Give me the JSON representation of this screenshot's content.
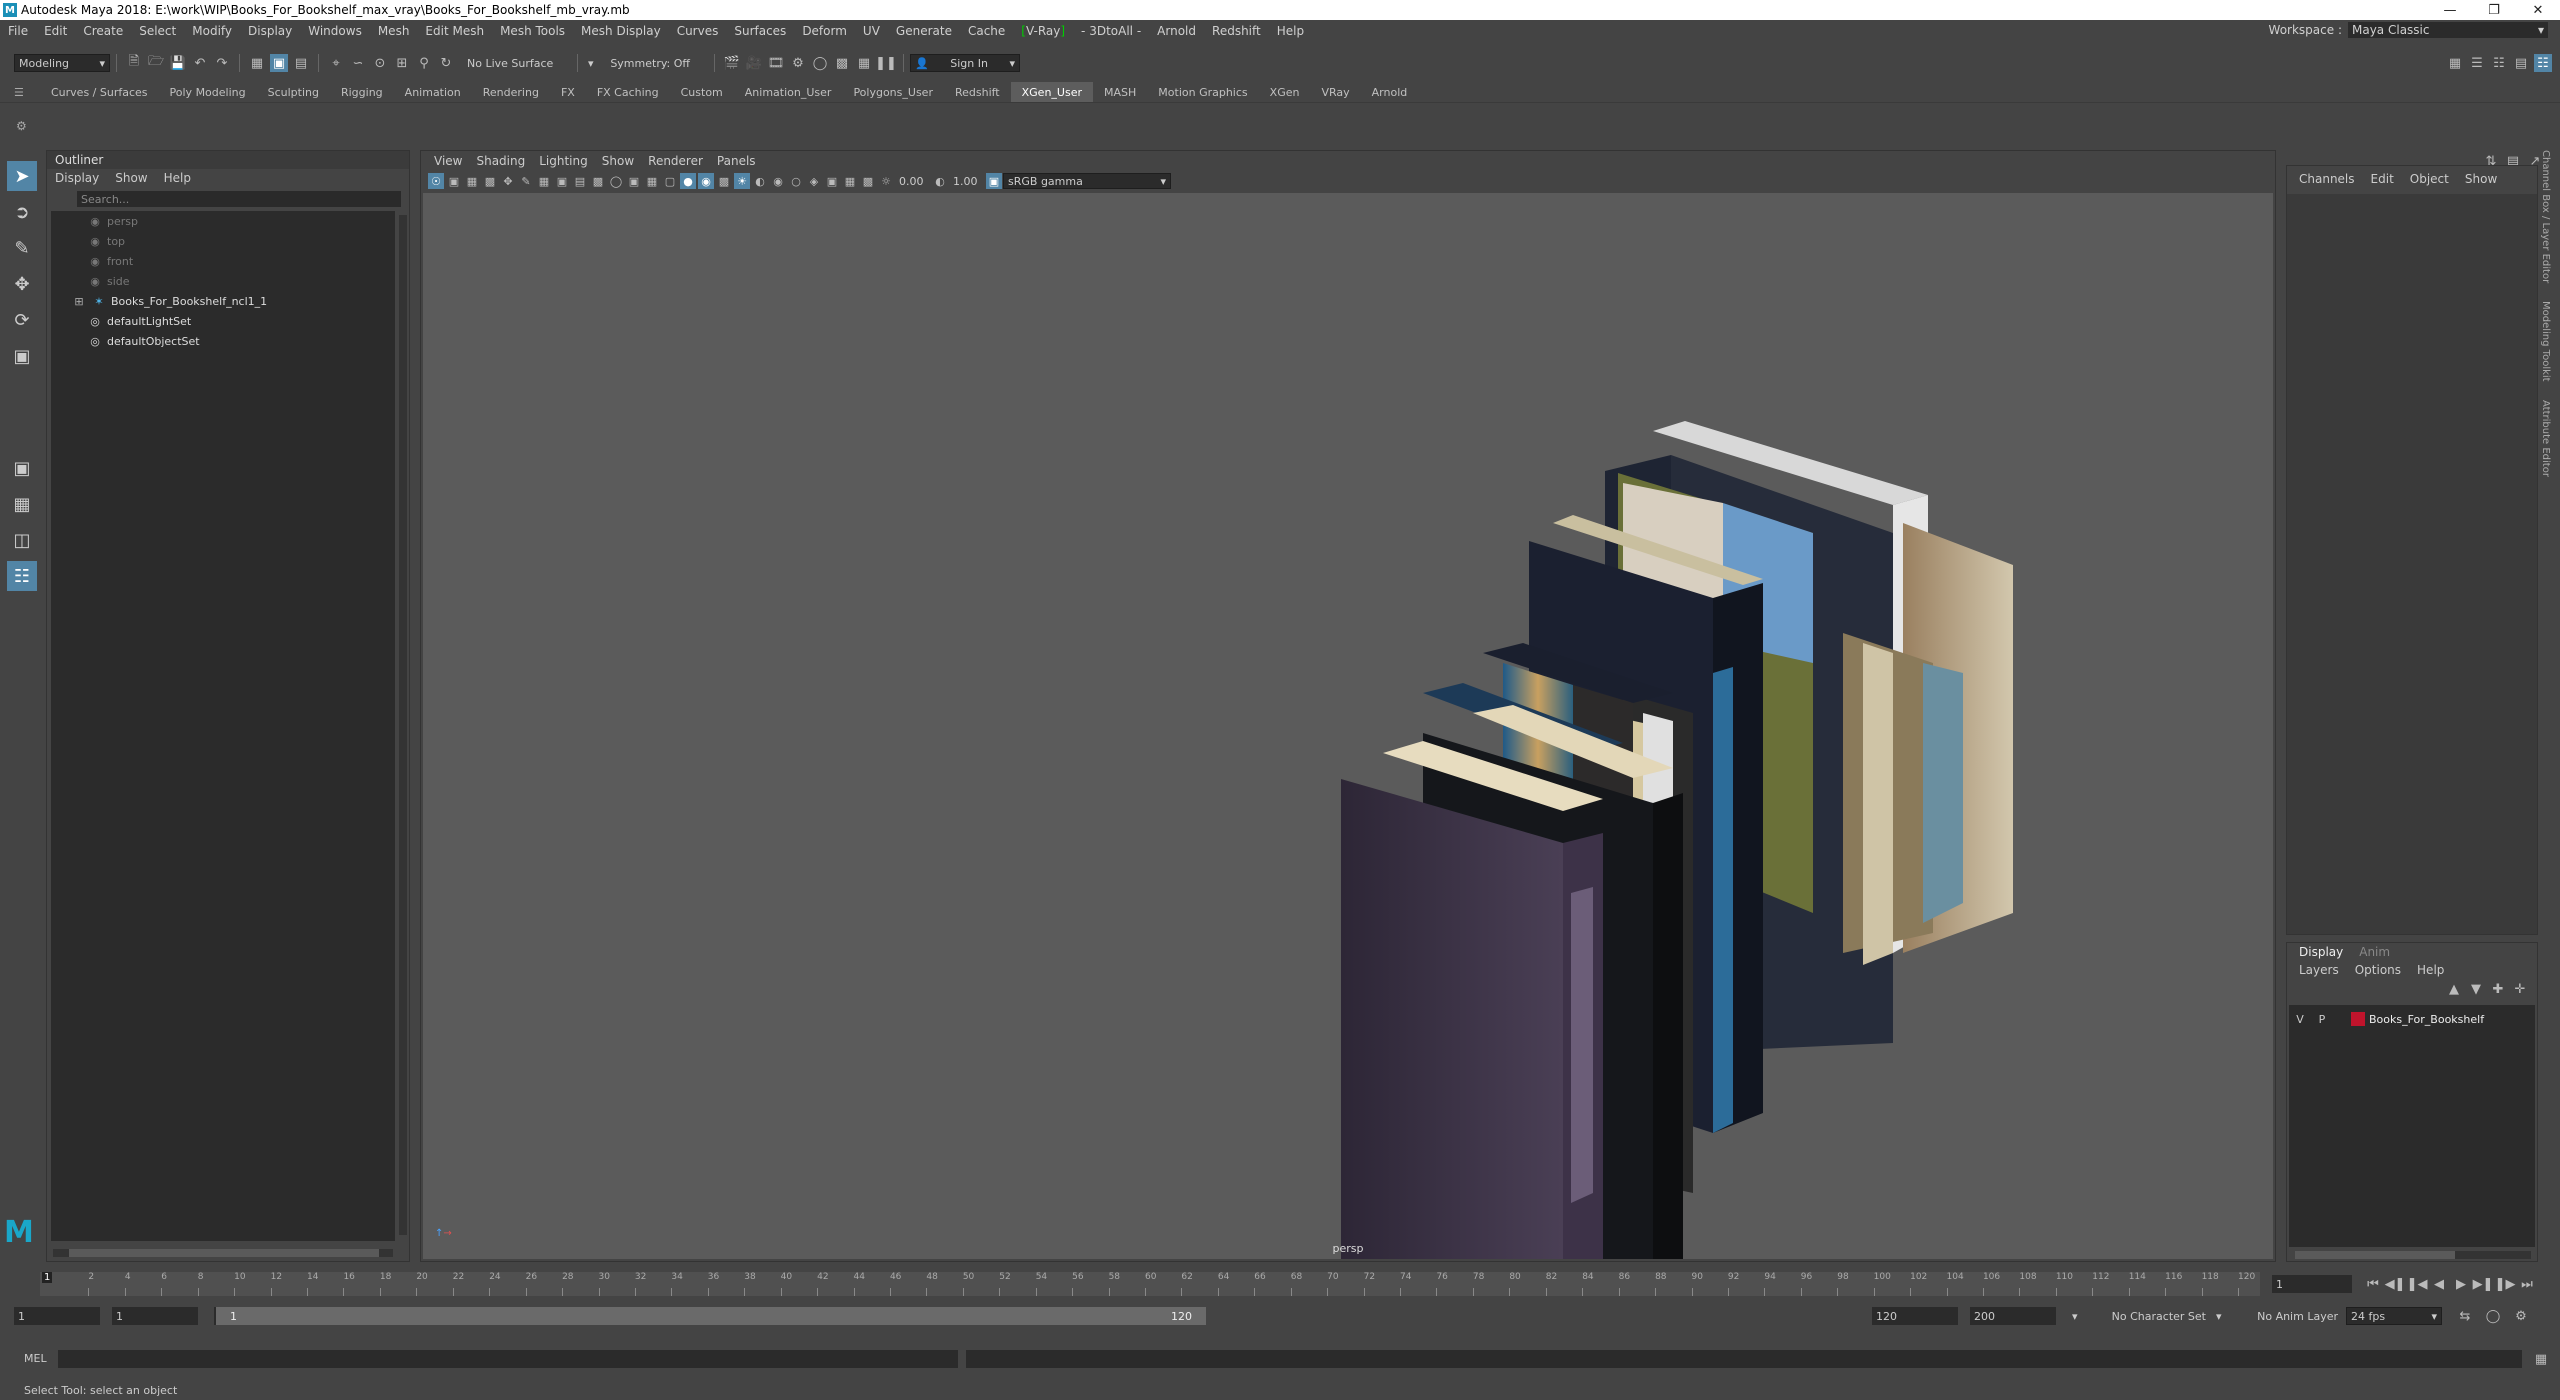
{
  "window": {
    "title": "Autodesk Maya 2018: E:\\work\\WIP\\Books_For_Bookshelf_max_vray\\Books_For_Bookshelf_mb_vray.mb",
    "logo": "M"
  },
  "menu": [
    "File",
    "Edit",
    "Create",
    "Select",
    "Modify",
    "Display",
    "Windows",
    "Mesh",
    "Edit Mesh",
    "Mesh Tools",
    "Mesh Display",
    "Curves",
    "Surfaces",
    "Deform",
    "UV",
    "Generate",
    "Cache",
    "V-Ray",
    "3DtoAll",
    "Arnold",
    "Redshift",
    "Help"
  ],
  "workspace": {
    "label": "Workspace :",
    "value": "Maya Classic"
  },
  "status": {
    "mode": "Modeling",
    "live_surface": "No Live Surface",
    "symmetry": "Symmetry: Off",
    "sign_in": "Sign In"
  },
  "shelf_tabs": [
    "Curves / Surfaces",
    "Poly Modeling",
    "Sculpting",
    "Rigging",
    "Animation",
    "Rendering",
    "FX",
    "FX Caching",
    "Custom",
    "Animation_User",
    "Polygons_User",
    "Redshift",
    "XGen_User",
    "MASH",
    "Motion Graphics",
    "XGen",
    "VRay",
    "Arnold"
  ],
  "shelf_active": "XGen_User",
  "outliner": {
    "title": "Outliner",
    "menu": [
      "Display",
      "Show",
      "Help"
    ],
    "search_placeholder": "Search...",
    "items": [
      {
        "label": "persp",
        "icon": "camera-icon",
        "dim": true
      },
      {
        "label": "top",
        "icon": "camera-icon",
        "dim": true
      },
      {
        "label": "front",
        "icon": "camera-icon",
        "dim": true
      },
      {
        "label": "side",
        "icon": "camera-icon",
        "dim": true
      },
      {
        "label": "Books_For_Bookshelf_ncl1_1",
        "icon": "group-icon",
        "dim": false
      },
      {
        "label": "defaultLightSet",
        "icon": "set-icon",
        "dim": false
      },
      {
        "label": "defaultObjectSet",
        "icon": "set-icon",
        "dim": false
      }
    ]
  },
  "viewport": {
    "menu": [
      "View",
      "Shading",
      "Lighting",
      "Show",
      "Renderer",
      "Panels"
    ],
    "exposure": "0.00",
    "gamma": "1.00",
    "color_space": "sRGB gamma",
    "camera_label": "persp"
  },
  "channelbox": {
    "menu": [
      "Channels",
      "Edit",
      "Object",
      "Show"
    ]
  },
  "layers": {
    "tabs": [
      "Display",
      "Anim"
    ],
    "menu": [
      "Layers",
      "Options",
      "Help"
    ],
    "row": {
      "v": "V",
      "p": "P",
      "name": "Books_For_Bookshelf",
      "color": "#c0142c"
    }
  },
  "side_tabs": [
    "Channel Box / Layer Editor",
    "Modeling Toolkit",
    "Attribute Editor"
  ],
  "timeline": {
    "ticks": [
      "2",
      "4",
      "6",
      "8",
      "10",
      "12",
      "14",
      "16",
      "18",
      "20",
      "22",
      "24",
      "26",
      "28",
      "30",
      "32",
      "34",
      "36",
      "38",
      "40",
      "42",
      "44",
      "46",
      "48",
      "50",
      "52",
      "54",
      "56",
      "58",
      "60",
      "62",
      "64",
      "66",
      "68",
      "70",
      "72",
      "74",
      "76",
      "78",
      "80",
      "82",
      "84",
      "86",
      "88",
      "90",
      "92",
      "94",
      "96",
      "98",
      "100",
      "102",
      "104",
      "106",
      "108",
      "110",
      "112",
      "114",
      "116",
      "118",
      "120"
    ],
    "current_frame": "1",
    "current_marker": "1"
  },
  "range": {
    "start": "1",
    "start2": "1",
    "slider_start": "1",
    "slider_end": "120",
    "end": "120",
    "end2": "200",
    "character_set": "No Character Set",
    "anim_layer": "No Anim Layer",
    "fps": "24 fps"
  },
  "cmdline": {
    "label": "MEL"
  },
  "helpline": "Select Tool: select an object"
}
